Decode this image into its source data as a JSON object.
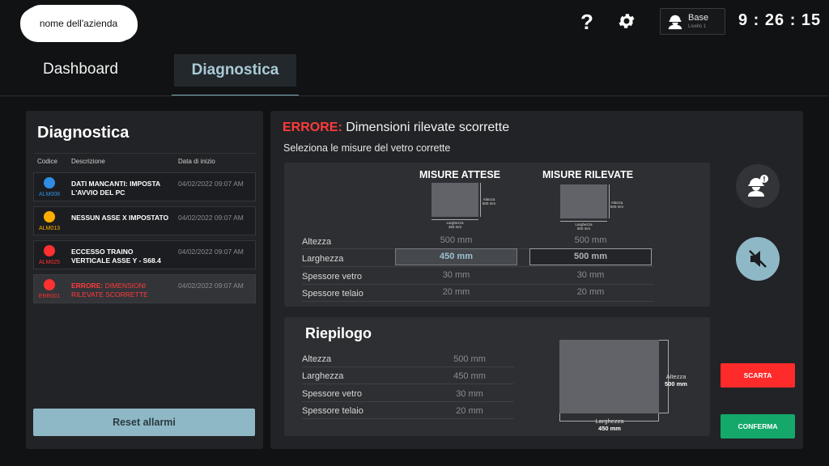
{
  "header": {
    "company_name": "nome dell'azienda",
    "help_glyph": "?",
    "user": {
      "name": "Base",
      "level": "Livello 1"
    },
    "clock": "9 : 26 : 15"
  },
  "tabs": [
    {
      "label": "Dashboard",
      "active": false
    },
    {
      "label": "Diagnostica",
      "active": true
    }
  ],
  "diagnostics_panel": {
    "title": "Diagnostica",
    "columns": {
      "code": "Codice",
      "description": "Descrizione",
      "start_date": "Data di inizio"
    },
    "alarms": [
      {
        "code": "ALM008",
        "color": "#2f8de4",
        "code_color": "#2f8de4",
        "description": "DATI MANCANTI: IMPOSTA L'AVVIO DEL PC",
        "date": "04/02/2022 09:07 AM"
      },
      {
        "code": "ALM013",
        "color": "#ffae00",
        "code_color": "#ffae00",
        "description": "NESSUN ASSE X IMPOSTATO",
        "date": "04/02/2022 09:07 AM"
      },
      {
        "code": "ALM025",
        "color": "#ff3030",
        "code_color": "#ff3030",
        "description": "ECCESSO TRAINO VERTICALE ASSE Y - S68.4",
        "date": "04/02/2022 09:07 AM"
      },
      {
        "code": "ERR001",
        "color": "#ff3030",
        "code_color": "#ff3030",
        "description_prefix": "ERRORE:",
        "description": "DIMENSIONI RILEVATE SCORRETTE",
        "date": "04/02/2022 09:07 AM"
      }
    ],
    "reset_label": "Reset allarmi"
  },
  "error": {
    "label": "ERRORE:",
    "title": "Dimensioni rilevate scorrette",
    "subtitle": "Seleziona le misure del vetro corrette"
  },
  "measures": {
    "expected_header": "MISURE ATTESE",
    "detected_header": "MISURE RILEVATE",
    "expected_diagram": {
      "height_label": "Altezza",
      "height_value": "500 mm",
      "width_label": "Larghezza",
      "width_value": "450 mm"
    },
    "detected_diagram": {
      "height_label": "Altezza",
      "height_value": "500 mm",
      "width_label": "Larghezza",
      "width_value": "500 mm"
    },
    "rows": [
      {
        "label": "Altezza",
        "expected": "500 mm",
        "detected": "500 mm"
      },
      {
        "label": "Larghezza",
        "expected": "450 mm",
        "detected": "500 mm"
      },
      {
        "label": "Spessore vetro",
        "expected": "30 mm",
        "detected": "30 mm"
      },
      {
        "label": "Spessore telaio",
        "expected": "20 mm",
        "detected": "20 mm"
      }
    ]
  },
  "summary": {
    "title": "Riepilogo",
    "rows": [
      {
        "label": "Altezza",
        "value": "500 mm"
      },
      {
        "label": "Larghezza",
        "value": "450 mm"
      },
      {
        "label": "Spessore vetro",
        "value": "30 mm"
      },
      {
        "label": "Spessore telaio",
        "value": "20 mm"
      }
    ],
    "diagram": {
      "height_label": "Altezza",
      "height_value": "500 mm",
      "width_label": "Larghezza",
      "width_value": "450 mm"
    }
  },
  "actions": {
    "discard": "SCARTA",
    "confirm": "CONFERMA"
  },
  "colors": {
    "accent": "#8fb8c6",
    "error": "#ff3b3b",
    "discard": "#ff2b2b",
    "confirm": "#14a86a"
  }
}
